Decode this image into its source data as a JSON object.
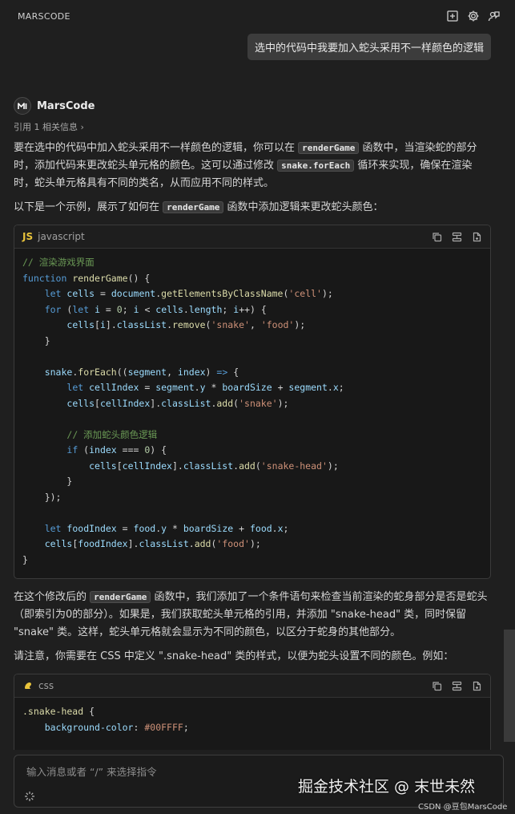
{
  "header": {
    "title": "MARSCODE",
    "icons": [
      "new-chat-icon",
      "gear-icon",
      "feedback-icon"
    ]
  },
  "user_message": "选中的代码中我要加入蛇头采用不一样颜色的逻辑",
  "assistant": {
    "name": "MarsCode",
    "reference": "引用 1 相关信息",
    "p1": {
      "a": "要在选中的代码中加入蛇头采用不一样颜色的逻辑，你可以在 ",
      "code1": "renderGame",
      "b": " 函数中，当渲染蛇的部分时，添加代码来更改蛇头单元格的颜色。这可以通过修改 ",
      "code2": "snake.forEach",
      "c": " 循环来实现，确保在渲染时，蛇头单元格具有不同的类名，从而应用不同的样式。"
    },
    "p2": {
      "a": "以下是一个示例，展示了如何在 ",
      "code1": "renderGame",
      "b": " 函数中添加逻辑来更改蛇头颜色："
    },
    "code_block_1": {
      "language": "javascript",
      "badge": "JS"
    },
    "p3": {
      "a": "在这个修改后的 ",
      "code1": "renderGame",
      "b": " 函数中，我们添加了一个条件语句来检查当前渲染的蛇身部分是否是蛇头（即索引为0的部分）。如果是，我们获取蛇头单元格的引用，并添加 \"snake-head\" 类，同时保留 \"snake\" 类。这样，蛇头单元格就会显示为不同的颜色，以区分于蛇身的其他部分。"
    },
    "p4": "请注意，你需要在 CSS 中定义 \".snake-head\" 类的样式，以便为蛇头设置不同的颜色。例如：",
    "code_block_2": {
      "language": "css"
    }
  },
  "input": {
    "placeholder": "输入消息或者 “/” 来选择指令"
  },
  "watermark": "掘金技术社区 @ 末世未然",
  "csdn": "CSDN @豆包MarsCode"
}
